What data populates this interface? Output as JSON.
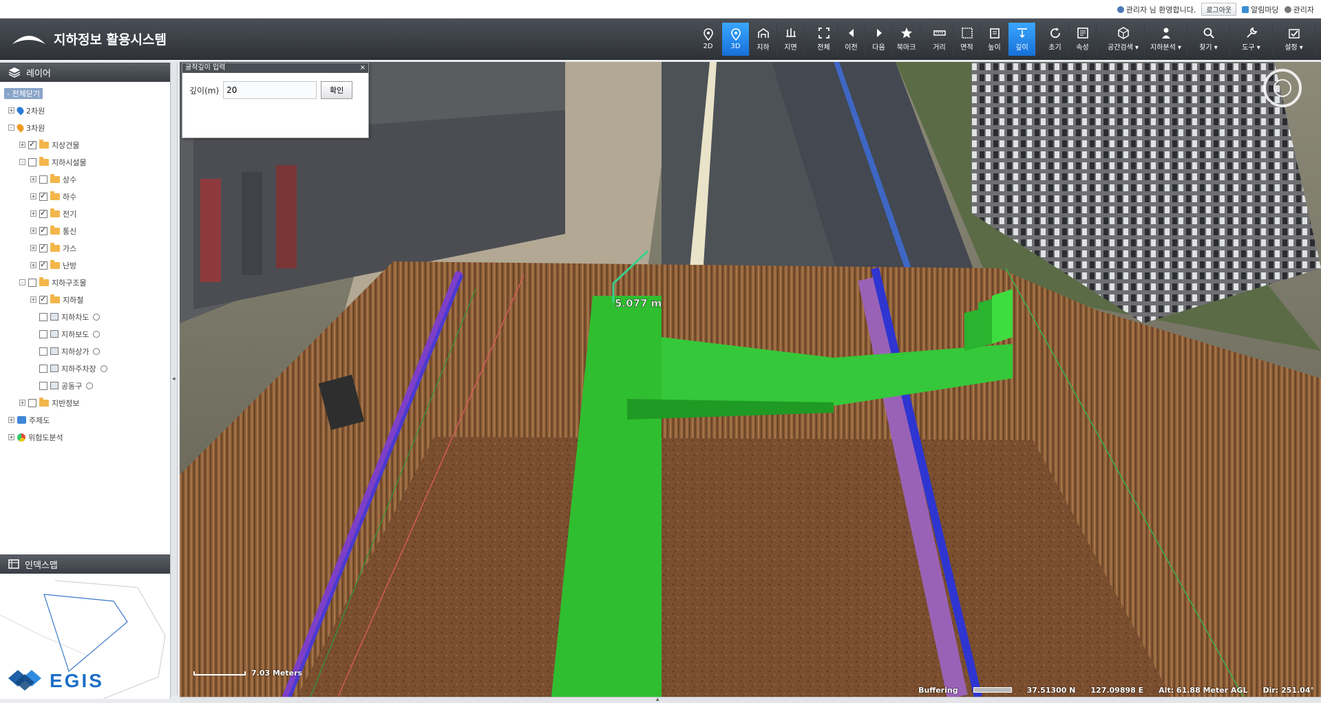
{
  "top": {
    "user_text": "관리자 님 환영합니다.",
    "logout": "로그아웃",
    "alarm": "알림마당",
    "admin": "관리자"
  },
  "app": {
    "title": "지하정보 활용시스템"
  },
  "toolbar": [
    {
      "label": "2D",
      "icon": "pin-icon"
    },
    {
      "label": "3D",
      "icon": "pin-icon",
      "active": true
    },
    {
      "label": "지하",
      "icon": "underground-icon"
    },
    {
      "label": "지면",
      "icon": "surface-icon"
    },
    {
      "label": "전체",
      "icon": "fullextent-icon"
    },
    {
      "label": "이전",
      "icon": "prev-icon"
    },
    {
      "label": "다음",
      "icon": "next-icon"
    },
    {
      "label": "북마크",
      "icon": "star-icon"
    },
    {
      "label": "거리",
      "icon": "ruler-icon"
    },
    {
      "label": "면적",
      "icon": "area-icon"
    },
    {
      "label": "높이",
      "icon": "height-icon"
    },
    {
      "label": "깊이",
      "icon": "depth-icon",
      "active": true
    },
    {
      "label": "초기",
      "icon": "refresh-icon"
    },
    {
      "label": "속성",
      "icon": "attribute-icon"
    },
    {
      "label": "공간검색 ▾",
      "icon": "cube-icon"
    },
    {
      "label": "지하분석 ▾",
      "icon": "person-pin-icon"
    },
    {
      "label": "찾기 ▾",
      "icon": "search-icon"
    },
    {
      "label": "도구 ▾",
      "icon": "tool-icon"
    },
    {
      "label": "설정 ▾",
      "icon": "settings-icon"
    }
  ],
  "layer_panel": {
    "title": "레이어",
    "collapse_all": "- 전체닫기",
    "nodes": [
      {
        "label": "2차원",
        "level": 0,
        "exp": "+",
        "cb": null,
        "icon": "pin-blue"
      },
      {
        "label": "3차원",
        "level": 0,
        "exp": "-",
        "cb": null,
        "icon": "pin-orange"
      },
      {
        "label": "지상건물",
        "level": 1,
        "exp": "+",
        "cb": true,
        "icon": "folder"
      },
      {
        "label": "지하시설물",
        "level": 1,
        "exp": "-",
        "cb": false,
        "icon": "folder"
      },
      {
        "label": "상수",
        "level": 2,
        "exp": "+",
        "cb": false,
        "icon": "folder"
      },
      {
        "label": "하수",
        "level": 2,
        "exp": "+",
        "cb": true,
        "icon": "folder"
      },
      {
        "label": "전기",
        "level": 2,
        "exp": "+",
        "cb": true,
        "icon": "folder"
      },
      {
        "label": "통신",
        "level": 2,
        "exp": "+",
        "cb": true,
        "icon": "folder"
      },
      {
        "label": "가스",
        "level": 2,
        "exp": "+",
        "cb": true,
        "icon": "folder"
      },
      {
        "label": "난방",
        "level": 2,
        "exp": "+",
        "cb": true,
        "icon": "folder"
      },
      {
        "label": "지하구조물",
        "level": 1,
        "exp": "-",
        "cb": false,
        "icon": "folder"
      },
      {
        "label": "지하철",
        "level": 2,
        "exp": "+",
        "cb": true,
        "icon": "folder"
      },
      {
        "label": "지하차도",
        "level": 2,
        "exp": "",
        "cb": false,
        "icon": "item",
        "radio": true
      },
      {
        "label": "지하보도",
        "level": 2,
        "exp": "",
        "cb": false,
        "icon": "item",
        "radio": true
      },
      {
        "label": "지하상가",
        "level": 2,
        "exp": "",
        "cb": false,
        "icon": "item",
        "radio": true
      },
      {
        "label": "지하주차장",
        "level": 2,
        "exp": "",
        "cb": false,
        "icon": "item",
        "radio": true
      },
      {
        "label": "공동구",
        "level": 2,
        "exp": "",
        "cb": false,
        "icon": "item",
        "radio": true
      },
      {
        "label": "지반정보",
        "level": 1,
        "exp": "+",
        "cb": false,
        "icon": "folder"
      },
      {
        "label": "주제도",
        "level": 0,
        "exp": "+",
        "cb": null,
        "icon": "layers-blue"
      },
      {
        "label": "위험도분석",
        "level": 0,
        "exp": "+",
        "cb": null,
        "icon": "chart-color"
      }
    ]
  },
  "index_map": {
    "title": "인덱스맵",
    "brand": "EGIS"
  },
  "depth_dialog": {
    "title": "굴착깊이 입력",
    "label": "깊이(m)",
    "value": "20",
    "confirm": "확인"
  },
  "map": {
    "measure_label": "5.077 m",
    "scale_text": "7.03 Meters",
    "status_buffering": "Buffering",
    "status_lat": "37.51300 N",
    "status_lon": "127.09898 E",
    "status_alt": "Alt: 61.88 Meter AGL",
    "status_dir": "Dir: 251.04°"
  }
}
